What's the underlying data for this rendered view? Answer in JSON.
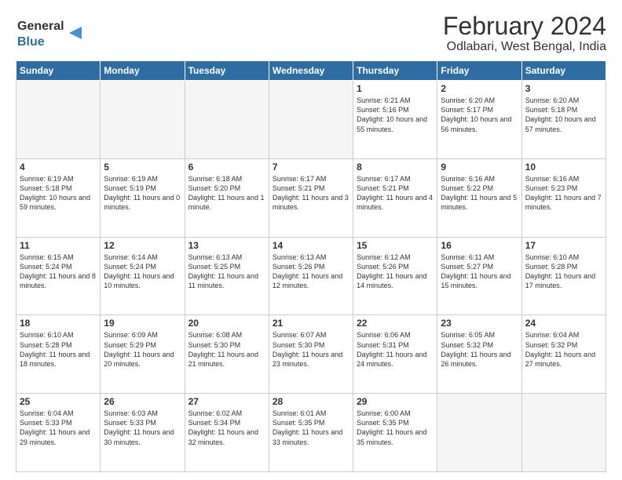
{
  "header": {
    "logo_general": "General",
    "logo_blue": "Blue",
    "title": "February 2024",
    "subtitle": "Odlabari, West Bengal, India"
  },
  "days_of_week": [
    "Sunday",
    "Monday",
    "Tuesday",
    "Wednesday",
    "Thursday",
    "Friday",
    "Saturday"
  ],
  "weeks": [
    [
      {
        "day": "",
        "info": ""
      },
      {
        "day": "",
        "info": ""
      },
      {
        "day": "",
        "info": ""
      },
      {
        "day": "",
        "info": ""
      },
      {
        "day": "1",
        "info": "Sunrise: 6:21 AM\nSunset: 5:16 PM\nDaylight: 10 hours\nand 55 minutes."
      },
      {
        "day": "2",
        "info": "Sunrise: 6:20 AM\nSunset: 5:17 PM\nDaylight: 10 hours\nand 56 minutes."
      },
      {
        "day": "3",
        "info": "Sunrise: 6:20 AM\nSunset: 5:18 PM\nDaylight: 10 hours\nand 57 minutes."
      }
    ],
    [
      {
        "day": "4",
        "info": "Sunrise: 6:19 AM\nSunset: 5:18 PM\nDaylight: 10 hours\nand 59 minutes."
      },
      {
        "day": "5",
        "info": "Sunrise: 6:19 AM\nSunset: 5:19 PM\nDaylight: 11 hours\nand 0 minutes."
      },
      {
        "day": "6",
        "info": "Sunrise: 6:18 AM\nSunset: 5:20 PM\nDaylight: 11 hours\nand 1 minute."
      },
      {
        "day": "7",
        "info": "Sunrise: 6:17 AM\nSunset: 5:21 PM\nDaylight: 11 hours\nand 3 minutes."
      },
      {
        "day": "8",
        "info": "Sunrise: 6:17 AM\nSunset: 5:21 PM\nDaylight: 11 hours\nand 4 minutes."
      },
      {
        "day": "9",
        "info": "Sunrise: 6:16 AM\nSunset: 5:22 PM\nDaylight: 11 hours\nand 5 minutes."
      },
      {
        "day": "10",
        "info": "Sunrise: 6:16 AM\nSunset: 5:23 PM\nDaylight: 11 hours\nand 7 minutes."
      }
    ],
    [
      {
        "day": "11",
        "info": "Sunrise: 6:15 AM\nSunset: 5:24 PM\nDaylight: 11 hours\nand 8 minutes."
      },
      {
        "day": "12",
        "info": "Sunrise: 6:14 AM\nSunset: 5:24 PM\nDaylight: 11 hours\nand 10 minutes."
      },
      {
        "day": "13",
        "info": "Sunrise: 6:13 AM\nSunset: 5:25 PM\nDaylight: 11 hours\nand 11 minutes."
      },
      {
        "day": "14",
        "info": "Sunrise: 6:13 AM\nSunset: 5:26 PM\nDaylight: 11 hours\nand 12 minutes."
      },
      {
        "day": "15",
        "info": "Sunrise: 6:12 AM\nSunset: 5:26 PM\nDaylight: 11 hours\nand 14 minutes."
      },
      {
        "day": "16",
        "info": "Sunrise: 6:11 AM\nSunset: 5:27 PM\nDaylight: 11 hours\nand 15 minutes."
      },
      {
        "day": "17",
        "info": "Sunrise: 6:10 AM\nSunset: 5:28 PM\nDaylight: 11 hours\nand 17 minutes."
      }
    ],
    [
      {
        "day": "18",
        "info": "Sunrise: 6:10 AM\nSunset: 5:28 PM\nDaylight: 11 hours\nand 18 minutes."
      },
      {
        "day": "19",
        "info": "Sunrise: 6:09 AM\nSunset: 5:29 PM\nDaylight: 11 hours\nand 20 minutes."
      },
      {
        "day": "20",
        "info": "Sunrise: 6:08 AM\nSunset: 5:30 PM\nDaylight: 11 hours\nand 21 minutes."
      },
      {
        "day": "21",
        "info": "Sunrise: 6:07 AM\nSunset: 5:30 PM\nDaylight: 11 hours\nand 23 minutes."
      },
      {
        "day": "22",
        "info": "Sunrise: 6:06 AM\nSunset: 5:31 PM\nDaylight: 11 hours\nand 24 minutes."
      },
      {
        "day": "23",
        "info": "Sunrise: 6:05 AM\nSunset: 5:32 PM\nDaylight: 11 hours\nand 26 minutes."
      },
      {
        "day": "24",
        "info": "Sunrise: 6:04 AM\nSunset: 5:32 PM\nDaylight: 11 hours\nand 27 minutes."
      }
    ],
    [
      {
        "day": "25",
        "info": "Sunrise: 6:04 AM\nSunset: 5:33 PM\nDaylight: 11 hours\nand 29 minutes."
      },
      {
        "day": "26",
        "info": "Sunrise: 6:03 AM\nSunset: 5:33 PM\nDaylight: 11 hours\nand 30 minutes."
      },
      {
        "day": "27",
        "info": "Sunrise: 6:02 AM\nSunset: 5:34 PM\nDaylight: 11 hours\nand 32 minutes."
      },
      {
        "day": "28",
        "info": "Sunrise: 6:01 AM\nSunset: 5:35 PM\nDaylight: 11 hours\nand 33 minutes."
      },
      {
        "day": "29",
        "info": "Sunrise: 6:00 AM\nSunset: 5:35 PM\nDaylight: 11 hours\nand 35 minutes."
      },
      {
        "day": "",
        "info": ""
      },
      {
        "day": "",
        "info": ""
      }
    ]
  ]
}
